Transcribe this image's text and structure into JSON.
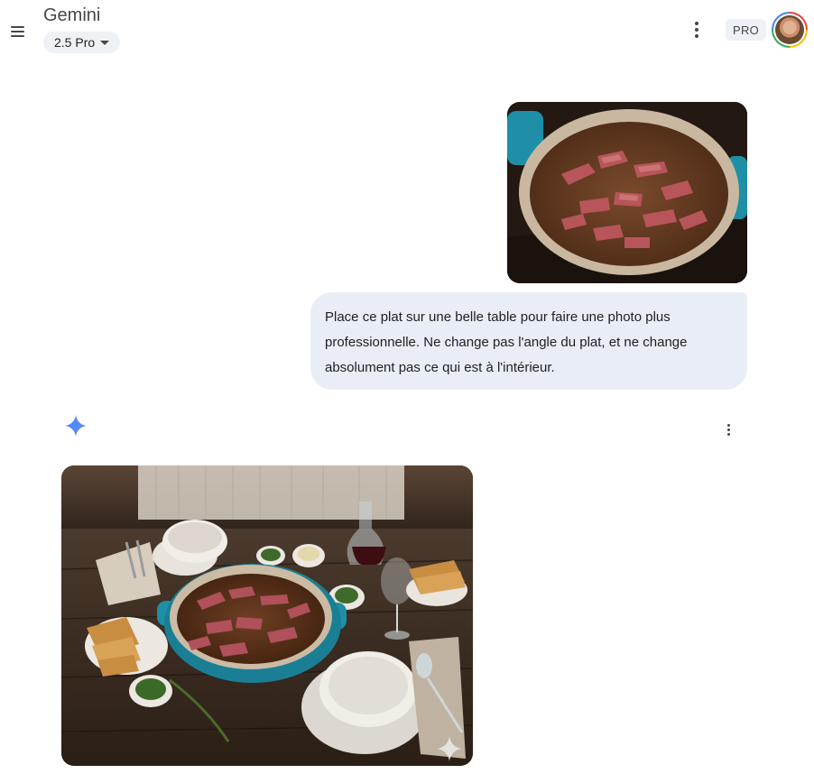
{
  "header": {
    "app_title": "Gemini",
    "model": "2.5 Pro",
    "plan_badge": "PRO",
    "menu_icon": "hamburger-menu-icon",
    "more_icon": "more-vertical-icon"
  },
  "conversation": {
    "user_image": {
      "subject": "braised sliced beef in teal cast iron pot"
    },
    "user_message": "Place ce plat sur une belle table pour faire une photo plus professionnelle. Ne change pas l'angle du plat, et ne change absolument pas ce qui est à l'intérieur.",
    "response_icon": "gemini-sparkle-icon",
    "response_more_icon": "more-vertical-icon",
    "response_image": {
      "subject": "pot of sliced beef on rustic wooden table with bowls, toasted bread, wine carafe and herbs"
    }
  },
  "colors": {
    "accent_blue": "#4285f4",
    "bubble_bg": "#e9eef6",
    "chip_bg": "#eef1f6",
    "pot_teal": "#1e8fa6"
  }
}
